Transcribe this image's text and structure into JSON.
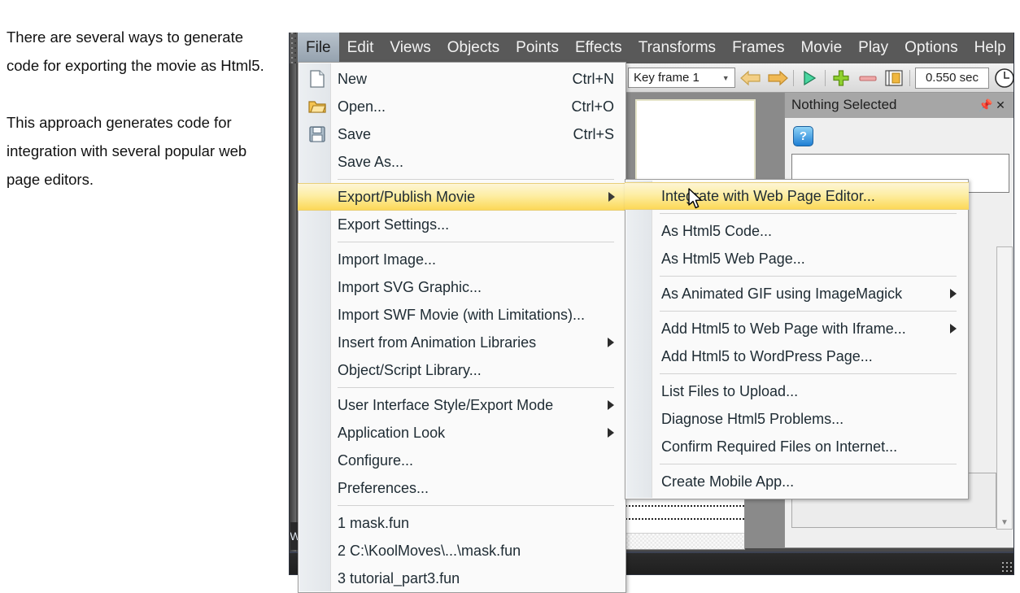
{
  "document_text": {
    "paragraphs": [
      "There are several ways to generate code for exporting the movie as Html5.",
      "This approach generates code for integration with several popular web page editors."
    ]
  },
  "app": {
    "menubar": [
      {
        "label": "File",
        "active": true
      },
      {
        "label": "Edit",
        "active": false
      },
      {
        "label": "Views",
        "active": false
      },
      {
        "label": "Objects",
        "active": false
      },
      {
        "label": "Points",
        "active": false
      },
      {
        "label": "Effects",
        "active": false
      },
      {
        "label": "Transforms",
        "active": false
      },
      {
        "label": "Frames",
        "active": false
      },
      {
        "label": "Movie",
        "active": false
      },
      {
        "label": "Play",
        "active": false
      },
      {
        "label": "Options",
        "active": false
      },
      {
        "label": "Help",
        "active": false
      }
    ],
    "toolbar": {
      "keyframe_value": "Key frame 1",
      "prev_icon": "left-arrow-icon",
      "next_icon": "right-arrow-icon",
      "play_icon": "play-icon",
      "add_icon": "plus-icon",
      "remove_icon": "minus-icon",
      "frames_icon": "frames-icon",
      "duration_value": "0.550 sec",
      "clock_icon": "clock-icon"
    },
    "right_panel": {
      "title": "Nothing Selected",
      "pin_icon": "pin-icon",
      "close_icon": "close-icon",
      "help_label": "?"
    },
    "file_menu": [
      {
        "label": "New",
        "shortcut": "Ctrl+N",
        "icon": "new-document-icon",
        "submenu": false,
        "highlight": false
      },
      {
        "label": "Open...",
        "shortcut": "Ctrl+O",
        "icon": "open-folder-icon",
        "submenu": false,
        "highlight": false
      },
      {
        "label": "Save",
        "shortcut": "Ctrl+S",
        "icon": "save-diskette-icon",
        "submenu": false,
        "highlight": false
      },
      {
        "label": "Save As...",
        "shortcut": "",
        "icon": "",
        "submenu": false,
        "highlight": false
      },
      {
        "separator": true
      },
      {
        "label": "Export/Publish Movie",
        "shortcut": "",
        "icon": "",
        "submenu": true,
        "highlight": true
      },
      {
        "label": "Export Settings...",
        "shortcut": "",
        "icon": "",
        "submenu": false,
        "highlight": false
      },
      {
        "separator": true
      },
      {
        "label": "Import Image...",
        "shortcut": "",
        "icon": "",
        "submenu": false,
        "highlight": false
      },
      {
        "label": "Import SVG Graphic...",
        "shortcut": "",
        "icon": "",
        "submenu": false,
        "highlight": false
      },
      {
        "label": "Import SWF Movie (with Limitations)...",
        "shortcut": "",
        "icon": "",
        "submenu": false,
        "highlight": false
      },
      {
        "label": "Insert from Animation Libraries",
        "shortcut": "",
        "icon": "",
        "submenu": true,
        "highlight": false
      },
      {
        "label": "Object/Script Library...",
        "shortcut": "",
        "icon": "",
        "submenu": false,
        "highlight": false
      },
      {
        "separator": true
      },
      {
        "label": "User Interface Style/Export Mode",
        "shortcut": "",
        "icon": "",
        "submenu": true,
        "highlight": false
      },
      {
        "label": "Application Look",
        "shortcut": "",
        "icon": "",
        "submenu": true,
        "highlight": false
      },
      {
        "label": "Configure...",
        "shortcut": "",
        "icon": "",
        "submenu": false,
        "highlight": false
      },
      {
        "label": "Preferences...",
        "shortcut": "",
        "icon": "",
        "submenu": false,
        "highlight": false
      },
      {
        "separator": true
      },
      {
        "label": "1 mask.fun",
        "shortcut": "",
        "icon": "",
        "submenu": false,
        "highlight": false
      },
      {
        "label": "2 C:\\KoolMoves\\...\\mask.fun",
        "shortcut": "",
        "icon": "",
        "submenu": false,
        "highlight": false
      },
      {
        "label": "3 tutorial_part3.fun",
        "shortcut": "",
        "icon": "",
        "submenu": false,
        "highlight": false
      }
    ],
    "export_submenu": [
      {
        "label": "Integrate with Web Page Editor...",
        "submenu": false,
        "highlight": true
      },
      {
        "separator": true
      },
      {
        "label": "As Html5 Code...",
        "submenu": false,
        "highlight": false
      },
      {
        "label": "As Html5 Web Page...",
        "submenu": false,
        "highlight": false
      },
      {
        "separator": true
      },
      {
        "label": "As Animated GIF using ImageMagick",
        "submenu": true,
        "highlight": false
      },
      {
        "separator": true
      },
      {
        "label": "Add Html5 to Web Page with Iframe...",
        "submenu": true,
        "highlight": false
      },
      {
        "label": "Add Html5 to WordPress Page...",
        "submenu": false,
        "highlight": false
      },
      {
        "separator": true
      },
      {
        "label": "List Files to Upload...",
        "submenu": false,
        "highlight": false
      },
      {
        "label": "Diagnose Html5 Problems...",
        "submenu": false,
        "highlight": false
      },
      {
        "label": "Confirm Required Files on Internet...",
        "submenu": false,
        "highlight": false
      },
      {
        "separator": true
      },
      {
        "label": "Create Mobile App...",
        "submenu": false,
        "highlight": false
      }
    ],
    "colors": {
      "menubar_bg": "#595959",
      "highlight_yellow": "#fcd857",
      "panel_title_bg": "#a6a6a6",
      "menu_bg": "#fafafa",
      "menu_text": "#1e2b33"
    },
    "left_tab_label": "W",
    "cursor_icon": "mouse-pointer-icon"
  }
}
